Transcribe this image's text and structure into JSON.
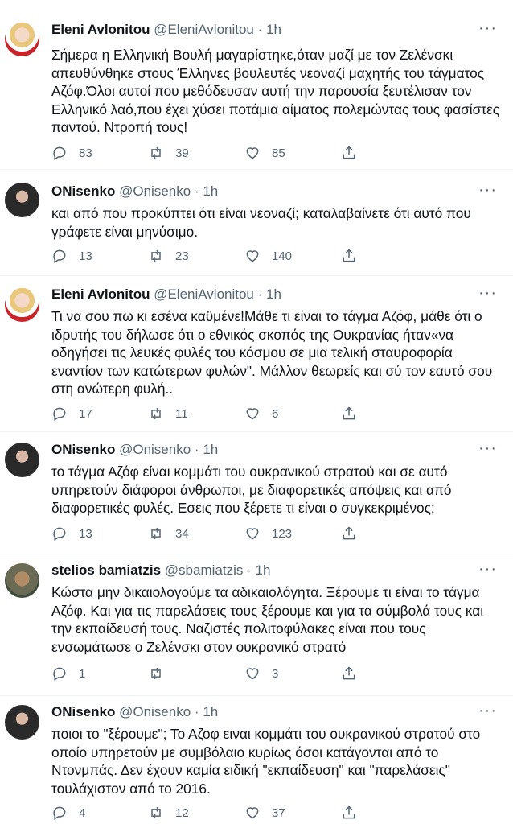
{
  "tweets": [
    {
      "name": "Eleni Avlonitou",
      "handle": "@EleniAvlonitou",
      "separator": "·",
      "time": "1h",
      "text": "Σήμερα η Ελληνική Βουλή μαγαρίστηκε,όταν μαζί με τον Ζελένσκι απευθύνθηκε στους Έλληνες βουλευτές νεοναζί μαχητής του τάγματος Αζόφ.Όλοι αυτοί που μεθόδευσαν αυτή την παρουσία ξευτέλισαν τον Ελληνικό λαό,που έχει χύσει ποτάμια αίματος πολεμώντας τους φασίστες παντού. Ντροπή τους!",
      "replies": "83",
      "retweets": "39",
      "likes": "85",
      "more": "···"
    },
    {
      "name": "ONisenko",
      "handle": "@Onisenko",
      "separator": "·",
      "time": "1h",
      "text": "και από που προκύπτει ότι είναι νεοναζί; καταλαβαίνετε ότι αυτό που γράφετε είναι μηνύσιμο.",
      "replies": "13",
      "retweets": "23",
      "likes": "140",
      "more": "···"
    },
    {
      "name": "Eleni Avlonitou",
      "handle": "@EleniAvlonitou",
      "separator": "·",
      "time": "1h",
      "text": "Τι να σου πω κι εσένα καϋμένε!Μάθε τι είναι το τάγμα Αζόφ, μάθε ότι ο ιδρυτής του δήλωσε ότι ο εθνικός σκοπός της Ουκρανίας ήταν«να οδηγήσει τις λευκές φυλές του κόσμου σε μια τελική σταυροφορία εναντίον των κατώτερων φυλών\". Μάλλον θεωρείς και σύ τον εαυτό σου στη ανώτερη φυλή..",
      "replies": "17",
      "retweets": "11",
      "likes": "6",
      "more": "···"
    },
    {
      "name": "ONisenko",
      "handle": "@Onisenko",
      "separator": "·",
      "time": "1h",
      "text": "το τάγμα Αζόφ είναι κομμάτι του ουκρανικού στρατού και σε αυτό υπηρετούν διάφοροι άνθρωποι, με διαφορετικές απόψεις και από διαφορετικές φυλές. Εσεις που ξέρετε τι είναι ο συγκεκριμένος;",
      "replies": "13",
      "retweets": "34",
      "likes": "123",
      "more": "···"
    },
    {
      "name": "stelios bamiatzis",
      "handle": "@sbamiatzis",
      "separator": "·",
      "time": "1h",
      "text": "Κώστα μην δικαιολογούμε τα αδικαιολόγητα. Ξέρουμε τι είναι το τάγμα Αζόφ. Και για τις παρελάσεις τους ξέρουμε και για τα σύμβολά τους και την εκπαίδευσή τους. Ναζιστές πολιτοφύλακες είναι που τους ενσωμάτωσε ο Ζελένσκι στον ουκρανικό στρατό",
      "replies": "1",
      "retweets": "",
      "likes": "3",
      "more": "···"
    },
    {
      "name": "ONisenko",
      "handle": "@Onisenko",
      "separator": "·",
      "time": "1h",
      "text": "ποιοι το \"ξέρουμε\"; Το Αζοφ ειναι κομμάτι του ουκρανικού στρατού στο οποίο υπηρετούν με συμβόλαιο κυρίως όσοι κατάγονται από το Ντονμπάς. Δεν έχουν καμία ειδική \"εκπαίδευση\" και \"παρελάσεις\" τουλάχιστον από το 2016.",
      "replies": "4",
      "retweets": "12",
      "likes": "37",
      "more": "···"
    }
  ]
}
